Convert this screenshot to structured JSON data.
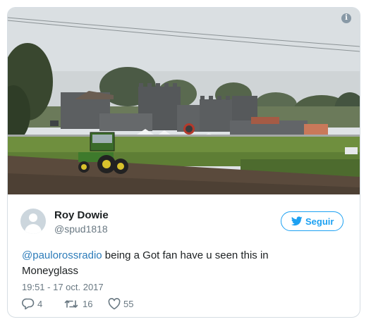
{
  "tweet": {
    "info_icon": "info-icon",
    "image_description_icon": "photo",
    "author": {
      "display_name": "Roy Dowie",
      "handle": "@spud1818",
      "avatar_icon": "default-avatar-icon"
    },
    "follow_button": {
      "label": "Seguir",
      "icon": "twitter-bird-icon"
    },
    "text": {
      "mention": "@paulorossradio",
      "body_line1": " being a Got fan have u seen this in",
      "body_line2": "Moneyglass"
    },
    "timestamp": "19:51 - 17 oct. 2017",
    "actions": {
      "reply_count": "4",
      "retweet_count": "16",
      "like_count": "55"
    },
    "colors": {
      "accent": "#1da1f2",
      "link": "#2b7bb9",
      "muted": "#697882",
      "text": "#1c2022",
      "border": "#d6dde3"
    }
  }
}
